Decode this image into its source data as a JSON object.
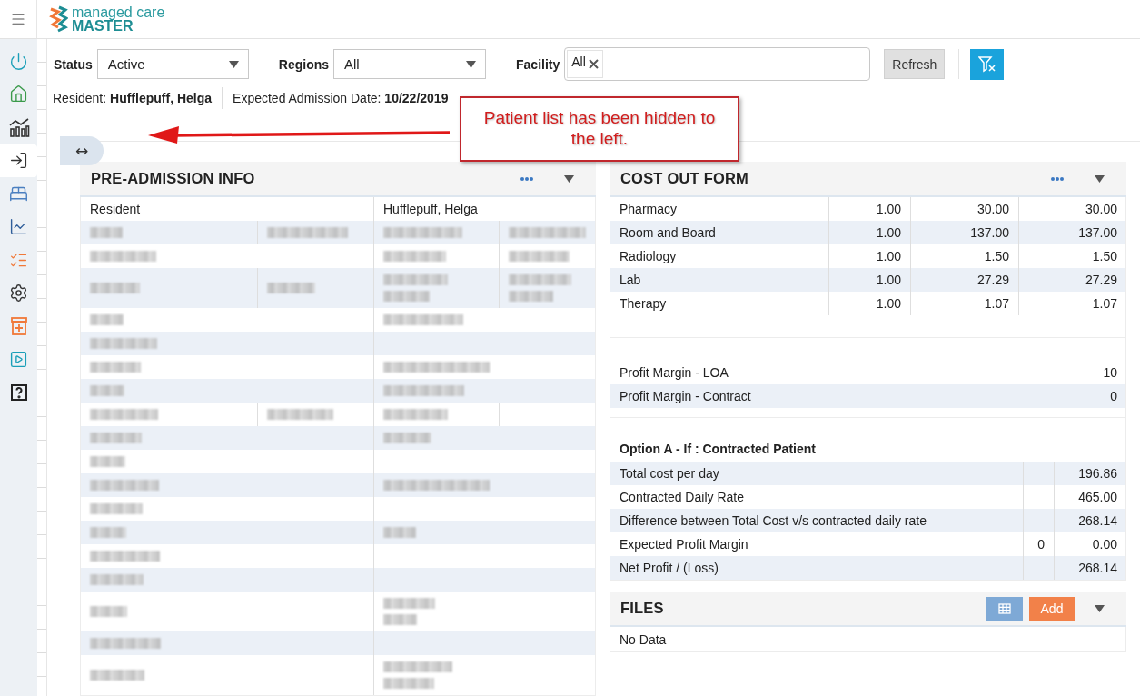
{
  "header": {
    "logo_top": "managed care",
    "logo_bottom": "MASTER"
  },
  "sidebar": {
    "items": [
      {
        "kind": "power",
        "selected": false
      },
      {
        "kind": "home",
        "selected": false
      },
      {
        "kind": "analytics",
        "selected": false
      },
      {
        "kind": "admit",
        "selected": true
      },
      {
        "kind": "bed",
        "selected": false
      },
      {
        "kind": "trend",
        "selected": false
      },
      {
        "kind": "checklist",
        "selected": false
      },
      {
        "kind": "settings",
        "selected": false
      },
      {
        "kind": "medical",
        "selected": false
      },
      {
        "kind": "play",
        "selected": false
      },
      {
        "kind": "help",
        "selected": false
      }
    ]
  },
  "filters": [
    {
      "kind": "select",
      "label": "Status",
      "value": "Active"
    },
    {
      "kind": "select",
      "label": "Regions",
      "value": "All"
    },
    {
      "kind": "tags",
      "label": "Facility",
      "tags": [
        "All"
      ]
    }
  ],
  "refresh_button": "Refresh",
  "resident": {
    "label": "Resident:",
    "name": "Hufflepuff, Helga",
    "date_label": "Expected Admission Date:",
    "date": "10/22/2019"
  },
  "callout": "Patient list has been hidden to the left.",
  "toggle": "↔",
  "pre_admission": {
    "title": "PRE-ADMISSION INFO",
    "header_row": [
      "Resident",
      "Hufflepuff, Helga"
    ],
    "rows": [
      {
        "cells": [
          {
            "kind": "blur"
          },
          {
            "kind": "blur"
          },
          {
            "kind": "blur"
          },
          {
            "kind": "blur"
          }
        ]
      },
      {
        "cells": [
          {
            "kind": "blur"
          },
          {
            "kind": "empty"
          },
          {
            "kind": "blur"
          },
          {
            "kind": "blur"
          }
        ]
      },
      {
        "cells": [
          {
            "kind": "blur"
          },
          {
            "kind": "blur"
          },
          {
            "kind": "blur2"
          },
          {
            "kind": "blur2"
          }
        ]
      },
      {
        "cells": [
          {
            "kind": "blur"
          },
          {
            "kind": "empty"
          },
          {
            "kind": "blur"
          },
          {
            "kind": "empty"
          }
        ]
      },
      {
        "cells": [
          {
            "kind": "blur"
          },
          {
            "kind": "empty"
          },
          {
            "kind": "empty"
          },
          {
            "kind": "empty"
          }
        ]
      },
      {
        "cells": [
          {
            "kind": "blur"
          },
          {
            "kind": "empty"
          },
          {
            "kind": "blurwide"
          },
          {
            "kind": "empty"
          }
        ]
      },
      {
        "cells": [
          {
            "kind": "blur"
          },
          {
            "kind": "empty"
          },
          {
            "kind": "blur"
          },
          {
            "kind": "empty"
          }
        ]
      },
      {
        "cells": [
          {
            "kind": "blur"
          },
          {
            "kind": "blur"
          },
          {
            "kind": "blur"
          },
          {
            "kind": "empty"
          }
        ]
      },
      {
        "cells": [
          {
            "kind": "blur"
          },
          {
            "kind": "empty"
          },
          {
            "kind": "blur"
          },
          {
            "kind": "empty"
          }
        ]
      },
      {
        "cells": [
          {
            "kind": "blur"
          },
          {
            "kind": "empty"
          },
          {
            "kind": "empty"
          },
          {
            "kind": "empty"
          }
        ]
      },
      {
        "cells": [
          {
            "kind": "blur"
          },
          {
            "kind": "empty"
          },
          {
            "kind": "blurwide"
          },
          {
            "kind": "empty"
          }
        ]
      },
      {
        "cells": [
          {
            "kind": "blur"
          },
          {
            "kind": "empty"
          },
          {
            "kind": "empty"
          },
          {
            "kind": "empty"
          }
        ]
      },
      {
        "cells": [
          {
            "kind": "blur"
          },
          {
            "kind": "empty"
          },
          {
            "kind": "blur"
          },
          {
            "kind": "empty"
          }
        ]
      },
      {
        "cells": [
          {
            "kind": "blur"
          },
          {
            "kind": "empty"
          },
          {
            "kind": "empty"
          },
          {
            "kind": "empty"
          }
        ]
      },
      {
        "cells": [
          {
            "kind": "blur"
          },
          {
            "kind": "empty"
          },
          {
            "kind": "empty"
          },
          {
            "kind": "empty"
          }
        ]
      },
      {
        "cells": [
          {
            "kind": "blur"
          },
          {
            "kind": "empty"
          },
          {
            "kind": "blur2"
          },
          {
            "kind": "empty"
          }
        ]
      },
      {
        "cells": [
          {
            "kind": "blur"
          },
          {
            "kind": "empty"
          },
          {
            "kind": "empty"
          },
          {
            "kind": "empty"
          }
        ]
      },
      {
        "cells": [
          {
            "kind": "blur"
          },
          {
            "kind": "empty"
          },
          {
            "kind": "blur2"
          },
          {
            "kind": "empty"
          }
        ]
      }
    ]
  },
  "cost_out": {
    "title": "COST OUT FORM",
    "items": [
      {
        "name": "Pharmacy",
        "values": [
          "1.00",
          "30.00",
          "30.00"
        ]
      },
      {
        "name": "Room and Board",
        "values": [
          "1.00",
          "137.00",
          "137.00"
        ]
      },
      {
        "name": "Radiology",
        "values": [
          "1.00",
          "1.50",
          "1.50"
        ]
      },
      {
        "name": "Lab",
        "values": [
          "1.00",
          "27.29",
          "27.29"
        ]
      },
      {
        "name": "Therapy",
        "values": [
          "1.00",
          "1.07",
          "1.07"
        ]
      }
    ],
    "margins": [
      {
        "label": "Profit Margin - LOA",
        "value": "10"
      },
      {
        "label": "Profit Margin - Contract",
        "value": "0"
      }
    ],
    "option_title": "Option A - If : Contracted Patient",
    "option_rows": [
      {
        "label": "Total cost per day",
        "value": "196.86"
      },
      {
        "label": "Contracted Daily Rate",
        "value": "465.00"
      },
      {
        "label": "Difference between Total Cost v/s contracted daily rate",
        "value": "268.14"
      },
      {
        "label": "Expected Profit Margin",
        "factor": "0",
        "value": "0.00"
      },
      {
        "label": "Net Profit / (Loss)",
        "value": "268.14"
      }
    ]
  },
  "files": {
    "title": "FILES",
    "add_button": "Add",
    "empty": "No Data"
  }
}
